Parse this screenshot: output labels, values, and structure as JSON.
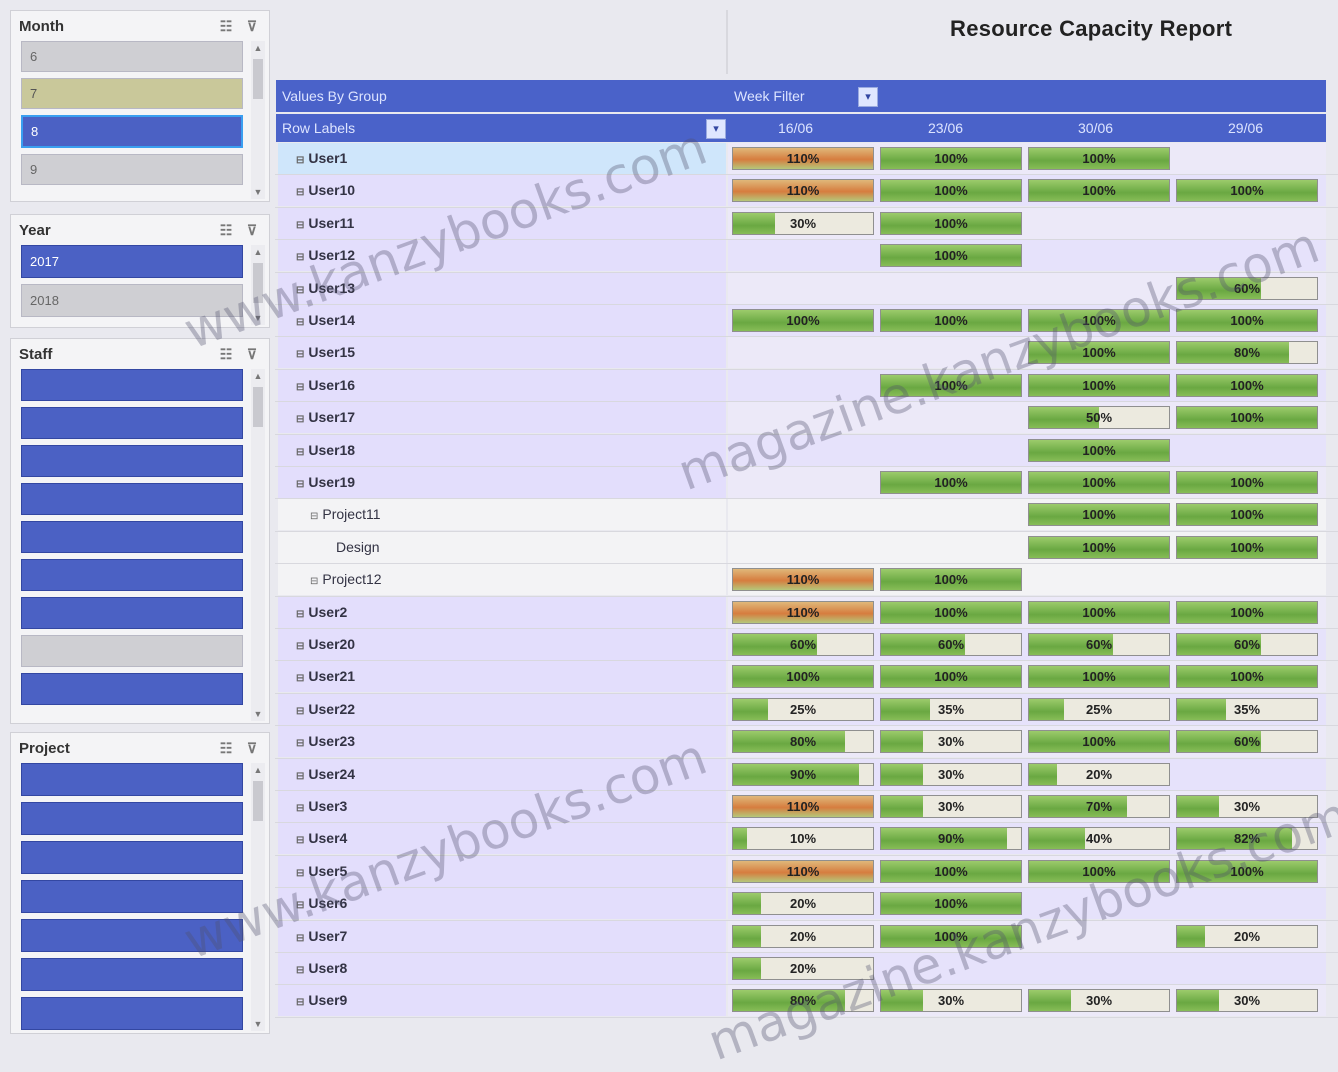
{
  "report": {
    "title": "Resource Capacity Report"
  },
  "slicers": {
    "month": {
      "label": "Month",
      "items": [
        "6",
        "7",
        "8",
        "9"
      ],
      "selected": [
        "8"
      ]
    },
    "year": {
      "label": "Year",
      "items": [
        "2017",
        "2018"
      ],
      "selected": [
        "2017"
      ]
    },
    "staff": {
      "label": "Staff",
      "items": [
        "",
        "",
        "",
        "",
        "",
        "",
        "",
        "",
        ""
      ]
    },
    "project": {
      "label": "Project",
      "items": [
        "",
        "",
        "",
        "",
        "",
        "",
        ""
      ]
    }
  },
  "pivot": {
    "row1": {
      "values_label": "Values By Group",
      "week_filter": "Week Filter"
    },
    "row2": {
      "row_labels": "Row Labels",
      "columns": [
        "16/06",
        "23/06",
        "30/06",
        "29/06"
      ]
    },
    "rows": [
      {
        "label": "User1",
        "values": [
          "110%",
          "100%",
          "100%",
          ""
        ],
        "style": "first"
      },
      {
        "label": "User10",
        "values": [
          "110%",
          "100%",
          "100%",
          "100%"
        ]
      },
      {
        "label": "User11",
        "values": [
          "30%",
          "100%",
          "",
          ""
        ]
      },
      {
        "label": "User12",
        "values": [
          "",
          "100%",
          "",
          ""
        ]
      },
      {
        "label": "User13",
        "values": [
          "",
          "",
          "",
          "60%"
        ]
      },
      {
        "label": "User14",
        "values": [
          "100%",
          "100%",
          "100%",
          "100%"
        ]
      },
      {
        "label": "User15",
        "values": [
          "",
          "",
          "100%",
          "80%"
        ]
      },
      {
        "label": "User16",
        "values": [
          "",
          "100%",
          "100%",
          "100%"
        ]
      },
      {
        "label": "User17",
        "values": [
          "",
          "",
          "50%",
          "100%"
        ]
      },
      {
        "label": "User18",
        "values": [
          "",
          "",
          "100%",
          ""
        ]
      },
      {
        "label": "User19",
        "values": [
          "",
          "100%",
          "100%",
          "100%"
        ]
      },
      {
        "label": "Project11",
        "values": [
          "",
          "",
          "100%",
          "100%"
        ],
        "style": "sub"
      },
      {
        "label": "Design",
        "values": [
          "",
          "",
          "100%",
          "100%"
        ],
        "style": "sub"
      },
      {
        "label": "Project12",
        "values": [
          "110%",
          "100%",
          "",
          ""
        ],
        "style": "sub"
      },
      {
        "label": "User2",
        "values": [
          "110%",
          "100%",
          "100%",
          "100%"
        ]
      },
      {
        "label": "User20",
        "values": [
          "60%",
          "60%",
          "60%",
          "60%"
        ]
      },
      {
        "label": "User21",
        "values": [
          "100%",
          "100%",
          "100%",
          "100%"
        ]
      },
      {
        "label": "User22",
        "values": [
          "25%",
          "35%",
          "25%",
          "35%"
        ]
      },
      {
        "label": "User23",
        "values": [
          "80%",
          "30%",
          "100%",
          "60%"
        ]
      },
      {
        "label": "User24",
        "values": [
          "90%",
          "30%",
          "20%",
          ""
        ]
      },
      {
        "label": "User3",
        "values": [
          "110%",
          "30%",
          "70%",
          "30%"
        ]
      },
      {
        "label": "User4",
        "values": [
          "10%",
          "90%",
          "40%",
          "82%"
        ]
      },
      {
        "label": "User5",
        "values": [
          "110%",
          "100%",
          "100%",
          "100%"
        ]
      },
      {
        "label": "User6",
        "values": [
          "20%",
          "100%",
          "",
          ""
        ]
      },
      {
        "label": "User7",
        "values": [
          "20%",
          "100%",
          "",
          "20%"
        ]
      },
      {
        "label": "User8",
        "values": [
          "20%",
          "",
          "",
          ""
        ]
      },
      {
        "label": "User9",
        "values": [
          "80%",
          "30%",
          "30%",
          "30%"
        ]
      }
    ]
  },
  "watermark": {
    "text1": "www.kanzybooks.com",
    "text2": "magazine.kanzybooks.com"
  },
  "colors": {
    "header": "#4a62c9",
    "row_label_bg": "#e3defc",
    "data_bar": "#6aa842",
    "over_capacity": "#d67d3f"
  }
}
